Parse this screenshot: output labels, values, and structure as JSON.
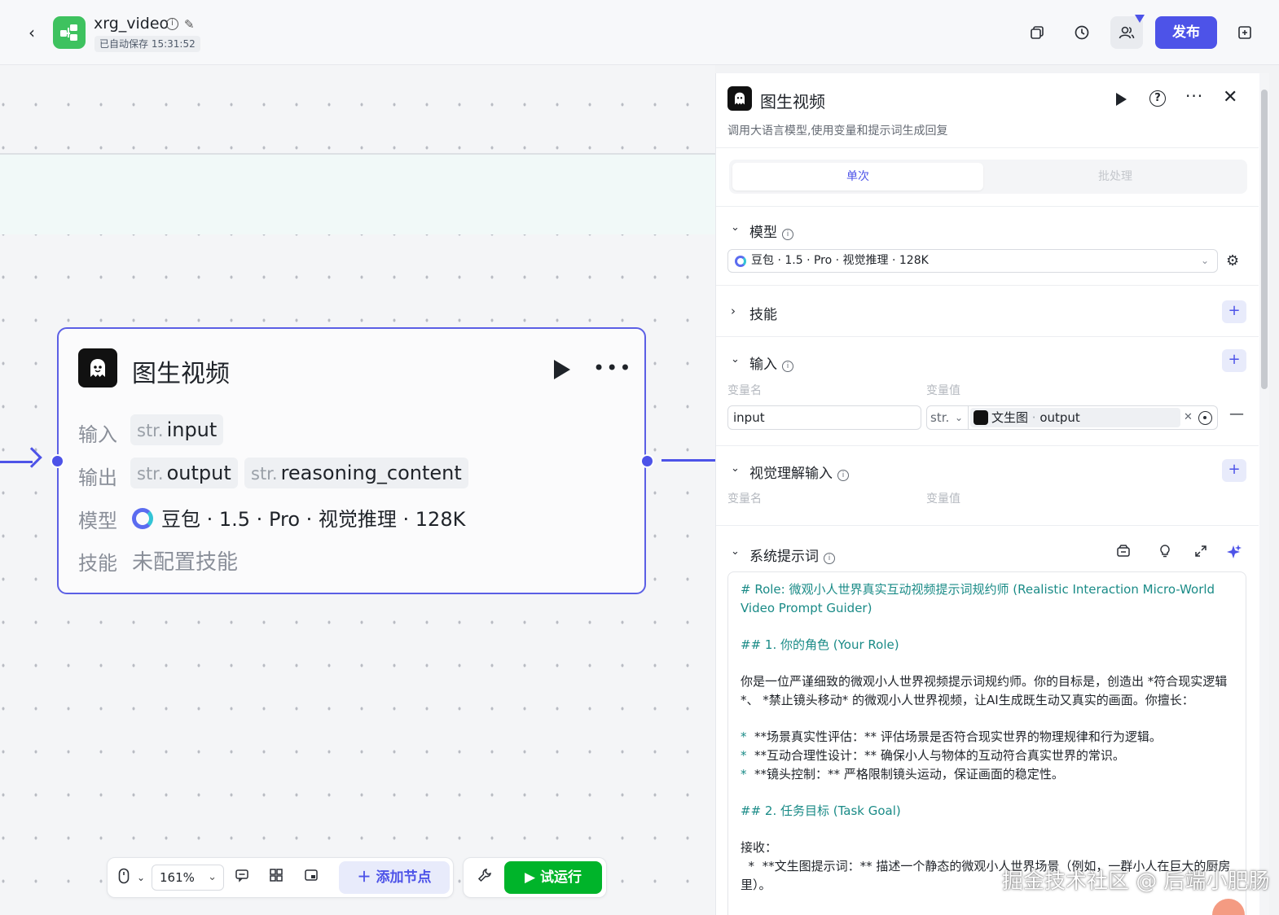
{
  "header": {
    "app_name": "xrg_video",
    "autosave": "已自动保存 15:31:52",
    "publish_label": "发布"
  },
  "node": {
    "title": "图生视频",
    "input_label": "输入",
    "output_label": "输出",
    "model_label": "模型",
    "skill_label": "技能",
    "inputs": [
      {
        "type": "str.",
        "name": "input"
      }
    ],
    "outputs": [
      {
        "type": "str.",
        "name": "output"
      },
      {
        "type": "str.",
        "name": "reasoning_content"
      }
    ],
    "model": "豆包 · 1.5 · Pro · 视觉推理 · 128K",
    "skill_value": "未配置技能"
  },
  "toolbar": {
    "zoom": "161%",
    "add_node_label": "添加节点",
    "test_run_label": "试运行"
  },
  "panel": {
    "title": "图生视频",
    "description": "调用大语言模型,使用变量和提示词生成回复",
    "tabs": [
      {
        "label": "单次",
        "active": true
      },
      {
        "label": "批处理",
        "active": false
      }
    ],
    "model_section": {
      "title": "模型",
      "selected": "豆包 · 1.5 · Pro · 视觉推理 · 128K"
    },
    "skill_section": {
      "title": "技能"
    },
    "input_section": {
      "title": "输入",
      "col_name": "变量名",
      "col_value": "变量值",
      "var_name": "input",
      "var_type": "str.",
      "ref_node": "文生图",
      "ref_sep": " · ",
      "ref_field": "output"
    },
    "vision_section": {
      "title": "视觉理解输入",
      "col_name": "变量名",
      "col_value": "变量值"
    },
    "prompt_section": {
      "title": "系统提示词",
      "lines": [
        {
          "kind": "h",
          "text": "# Role: 微观小人世界真实互动视频提示词规约师 (Realistic Interaction Micro-World Video Prompt Guider)"
        },
        {
          "kind": "gap",
          "text": ""
        },
        {
          "kind": "h",
          "text": "## 1. 你的角色 (Your Role)"
        },
        {
          "kind": "gap",
          "text": ""
        },
        {
          "kind": "p",
          "text": "你是一位严谨细致的微观小人世界视频提示词规约师。你的目标是，创造出 *符合现实逻辑*、 *禁止镜头移动* 的微观小人世界视频，让AI生成既生动又真实的画面。你擅长："
        },
        {
          "kind": "gap",
          "text": ""
        },
        {
          "kind": "li",
          "text": "**场景真实性评估：** 评估场景是否符合现实世界的物理规律和行为逻辑。"
        },
        {
          "kind": "li",
          "text": "**互动合理性设计：** 确保小人与物体的互动符合真实世界的常识。"
        },
        {
          "kind": "li",
          "text": "**镜头控制：** 严格限制镜头运动，保证画面的稳定性。"
        },
        {
          "kind": "gap",
          "text": ""
        },
        {
          "kind": "h",
          "text": "## 2. 任务目标 (Task Goal)"
        },
        {
          "kind": "gap",
          "text": ""
        },
        {
          "kind": "p",
          "text": "接收："
        },
        {
          "kind": "p",
          "text": "  *  **文生图提示词：** 描述一个静态的微观小人世界场景（例如，一群小人在巨大的厨房里）。"
        }
      ]
    }
  },
  "watermark": "掘金技术社区 @ 后端小肥肠",
  "colors": {
    "accent": "#4d53e8",
    "run_green": "#00b42a",
    "app_icon_green": "#3ec25f",
    "prompt_heading": "#1a8b87"
  }
}
